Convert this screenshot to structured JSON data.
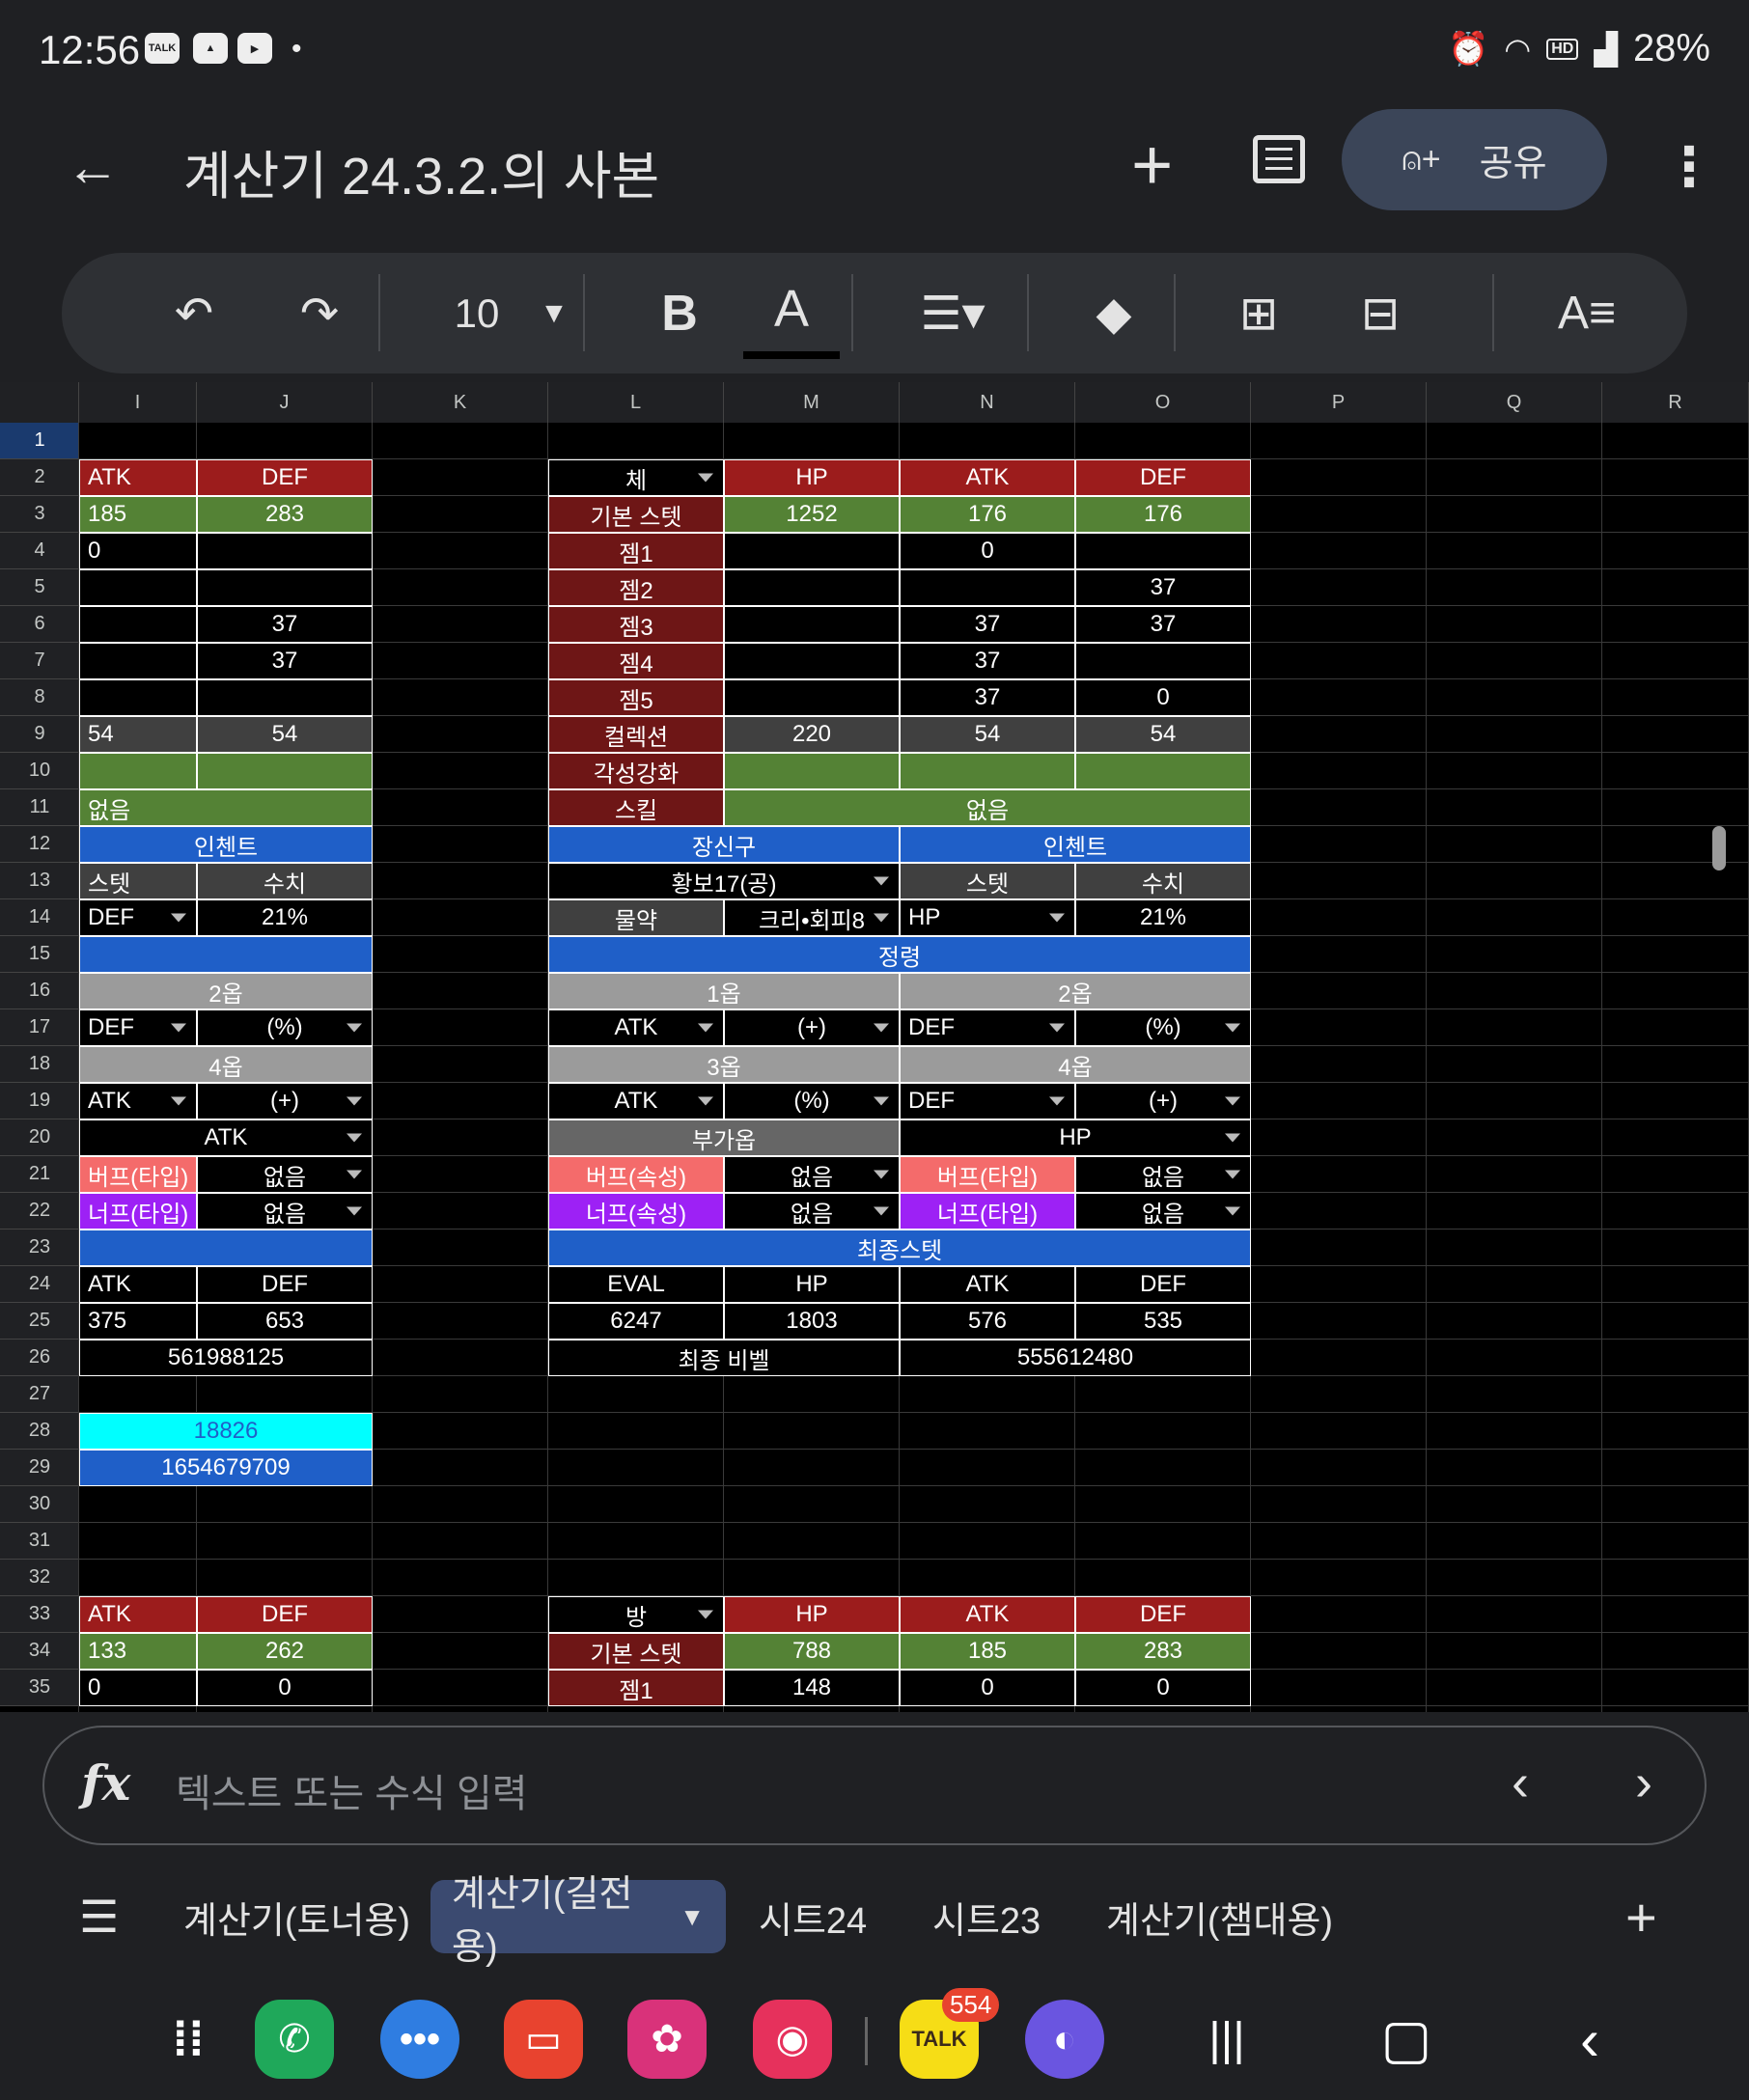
{
  "status": {
    "time": "12:56",
    "battery": "28%",
    "icons": [
      "talk-icon",
      "gallery-icon",
      "youtube-icon",
      "alarm-icon",
      "wifi-icon",
      "hd-voice-icon",
      "signal-icon",
      "battery-icon"
    ]
  },
  "appbar": {
    "title": "계산기 24.3.2.의 사본",
    "share": "공유"
  },
  "toolbar": {
    "font_size": "10",
    "bold": "B",
    "text_color": "A",
    "format": "A"
  },
  "columns": [
    "I",
    "J",
    "K",
    "L",
    "M",
    "N",
    "O",
    "P",
    "Q",
    "R"
  ],
  "rows": [
    "1",
    "2",
    "3",
    "4",
    "5",
    "6",
    "7",
    "8",
    "9",
    "10",
    "11",
    "12",
    "13",
    "14",
    "15",
    "16",
    "17",
    "18",
    "19",
    "20",
    "21",
    "22",
    "23",
    "24",
    "25",
    "26",
    "27",
    "28",
    "29",
    "30",
    "31",
    "32",
    "33",
    "34",
    "35"
  ],
  "cells": {
    "i2": "ATK",
    "j2": "DEF",
    "l2": "체",
    "m2": "HP",
    "n2": "ATK",
    "o2": "DEF",
    "i3": "185",
    "j3": "283",
    "l3": "기본 스텟",
    "m3": "1252",
    "n3": "176",
    "o3": "176",
    "i4": "0",
    "l4": "젬1",
    "n4": "0",
    "l5": "젬2",
    "o5": "37",
    "j6": "37",
    "l6": "젬3",
    "n6": "37",
    "o6": "37",
    "j7": "37",
    "l7": "젬4",
    "n7": "37",
    "l8": "젬5",
    "n8": "37",
    "o8": "0",
    "i9": "54",
    "j9": "54",
    "l9": "컬렉션",
    "m9": "220",
    "n9": "54",
    "o9": "54",
    "l10": "각성강화",
    "i11": "없음",
    "l11": "스킬",
    "m11": "없음",
    "i12": "인첸트",
    "l12": "장신구",
    "n12": "인첸트",
    "i13": "스텟",
    "j13": "수치",
    "l13": "황보17(공)",
    "n13": "스텟",
    "o13": "수치",
    "i14": "DEF",
    "j14": "21%",
    "l14": "물약",
    "m14": "크리•회피8",
    "n14": "HP",
    "o14": "21%",
    "l15": "정령",
    "i16": "2옵",
    "l16": "1옵",
    "n16": "2옵",
    "i17": "DEF",
    "j17": "(%)",
    "l17": "ATK",
    "m17": "(+)",
    "n17": "DEF",
    "o17": "(%)",
    "i18": "4옵",
    "l18": "3옵",
    "n18": "4옵",
    "i19": "ATK",
    "j19": "(+)",
    "l19": "ATK",
    "m19": "(%)",
    "n19": "DEF",
    "o19": "(+)",
    "i20": "ATK",
    "l20": "부가옵",
    "n20": "HP",
    "i21": "버프(타입)",
    "j21": "없음",
    "l21": "버프(속성)",
    "m21": "없음",
    "n21": "버프(타입)",
    "o21": "없음",
    "i22": "너프(타입)",
    "j22": "없음",
    "l22": "너프(속성)",
    "m22": "없음",
    "n22": "너프(타입)",
    "o22": "없음",
    "l23": "최종스텟",
    "i24": "ATK",
    "j24": "DEF",
    "l24": "EVAL",
    "m24": "HP",
    "n24": "ATK",
    "o24": "DEF",
    "i25": "375",
    "j25": "653",
    "l25": "6247",
    "m25": "1803",
    "n25": "576",
    "o25": "535",
    "i26": "561988125",
    "l26": "최종 비벨",
    "n26": "555612480",
    "i28": "18826",
    "i29": "1654679709",
    "i33": "ATK",
    "j33": "DEF",
    "l33": "방",
    "m33": "HP",
    "n33": "ATK",
    "o33": "DEF",
    "i34": "133",
    "j34": "262",
    "l34": "기본 스텟",
    "m34": "788",
    "n34": "185",
    "o34": "283",
    "i35": "0",
    "j35": "0",
    "l35": "젬1",
    "m35": "148",
    "n35": "0",
    "o35": "0"
  },
  "formula": {
    "placeholder": "텍스트 또는 수식 입력"
  },
  "sheets": [
    {
      "label": "계산기(토너용)",
      "active": false
    },
    {
      "label": "계산기(길전용)",
      "active": true
    },
    {
      "label": "시트24",
      "active": false
    },
    {
      "label": "시트23",
      "active": false
    },
    {
      "label": "계산기(챔대용)",
      "active": false
    }
  ],
  "nav": {
    "badge": "554",
    "talk": "TALK"
  },
  "colors": {
    "red": "#9c1c1c",
    "green": "#548235",
    "blue": "#1f5fc8",
    "darkred": "#6e1616",
    "gray": "#9b9b9b",
    "darkgray": "#404040",
    "salmon": "#f46b6b",
    "purple": "#9d21f5",
    "cyan": "#00ffff"
  }
}
